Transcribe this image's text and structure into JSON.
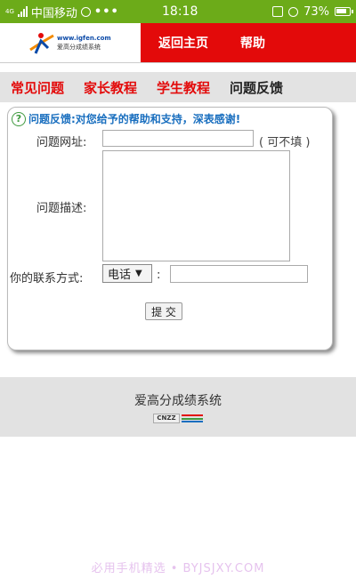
{
  "statusbar": {
    "network_label": "4G",
    "carrier": "中国移动",
    "more": "•••",
    "time": "18:18",
    "battery": "73%"
  },
  "header": {
    "logo_url": "www.igfen.com",
    "logo_name": "爱高分成绩系统",
    "nav": [
      "返回主页",
      "帮助"
    ]
  },
  "tabs": [
    "常见问题",
    "家长教程",
    "学生教程",
    "问题反馈"
  ],
  "form": {
    "notice": "问题反馈:对您给予的帮助和支持，深表感谢!",
    "url_label": "问题网址:",
    "url_value": "",
    "url_hint": "( 可不填 )",
    "desc_label": "问题描述:",
    "desc_value": "",
    "contact_label": "你的联系方式:",
    "contact_type": "电话",
    "contact_sep": ":",
    "contact_value": "",
    "submit_label": "提 交"
  },
  "footer": {
    "name": "爱高分成绩系统",
    "badge": "CNZZ"
  },
  "watermark": "必用手机精选 • BYJSJXY.COM",
  "colors": {
    "statusbar": "#6cab19",
    "header_red": "#e30a0a",
    "tab_red": "#e30a0a",
    "notice_blue": "#1a6fbf"
  }
}
